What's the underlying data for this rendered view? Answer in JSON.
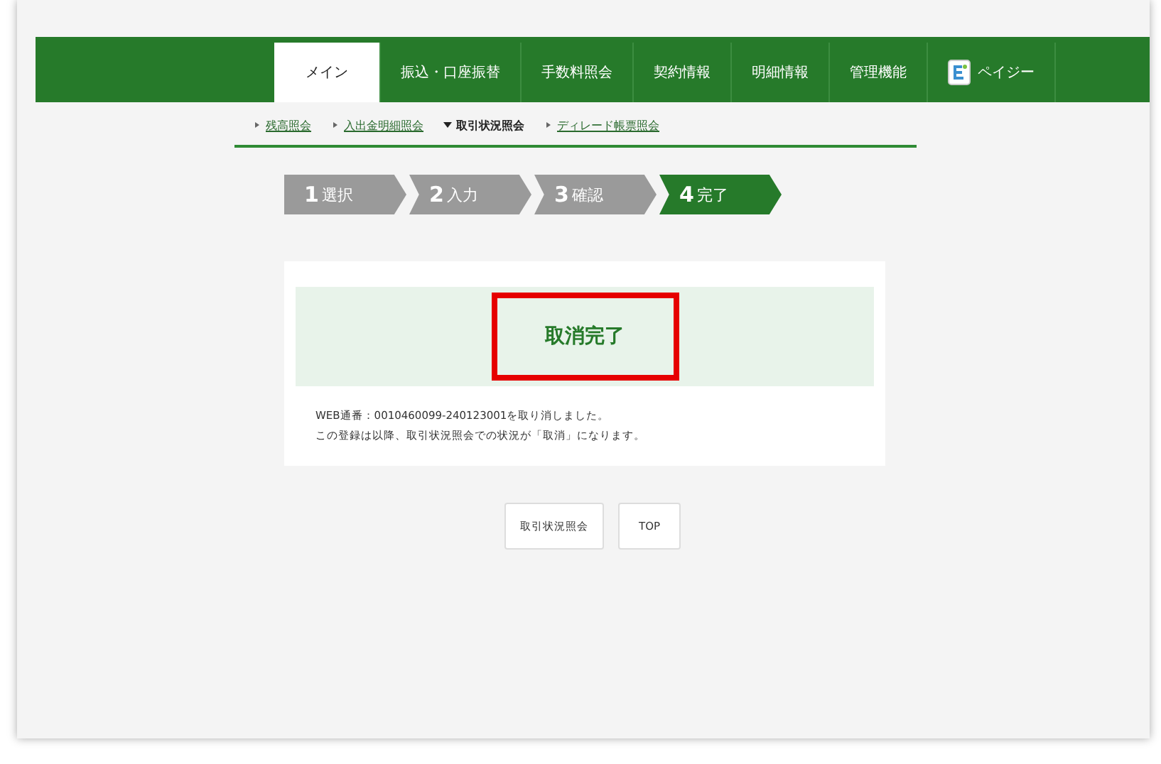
{
  "tabs": [
    {
      "label": "メイン",
      "selected": true,
      "kind": "text"
    },
    {
      "label": "振込・口座振替",
      "selected": false,
      "kind": "text"
    },
    {
      "label": "手数料照会",
      "selected": false,
      "kind": "text"
    },
    {
      "label": "契約情報",
      "selected": false,
      "kind": "text"
    },
    {
      "label": "明細情報",
      "selected": false,
      "kind": "text"
    },
    {
      "label": "管理機能",
      "selected": false,
      "kind": "text"
    },
    {
      "label": "ペイジー",
      "selected": false,
      "kind": "logo"
    }
  ],
  "subnav": [
    {
      "label": "残高照会",
      "selected": false
    },
    {
      "label": "入出金明細照会",
      "selected": false
    },
    {
      "label": "取引状況照会",
      "selected": true
    },
    {
      "label": "ディレード帳票照会",
      "selected": false
    }
  ],
  "steps": [
    {
      "number": "1",
      "label": "選択",
      "selected": false
    },
    {
      "number": "2",
      "label": "入力",
      "selected": false
    },
    {
      "number": "3",
      "label": "確認",
      "selected": false
    },
    {
      "number": "4",
      "label": "完了",
      "selected": true
    }
  ],
  "result": {
    "title": "取消完了",
    "highlighted": true
  },
  "messages": [
    "WEB通番：0010460099-240123001を取り消しました。",
    "この登録は以降、取引状況照会での状況が「取消」になります。"
  ],
  "buttons": [
    "取引状況照会",
    "TOP"
  ]
}
